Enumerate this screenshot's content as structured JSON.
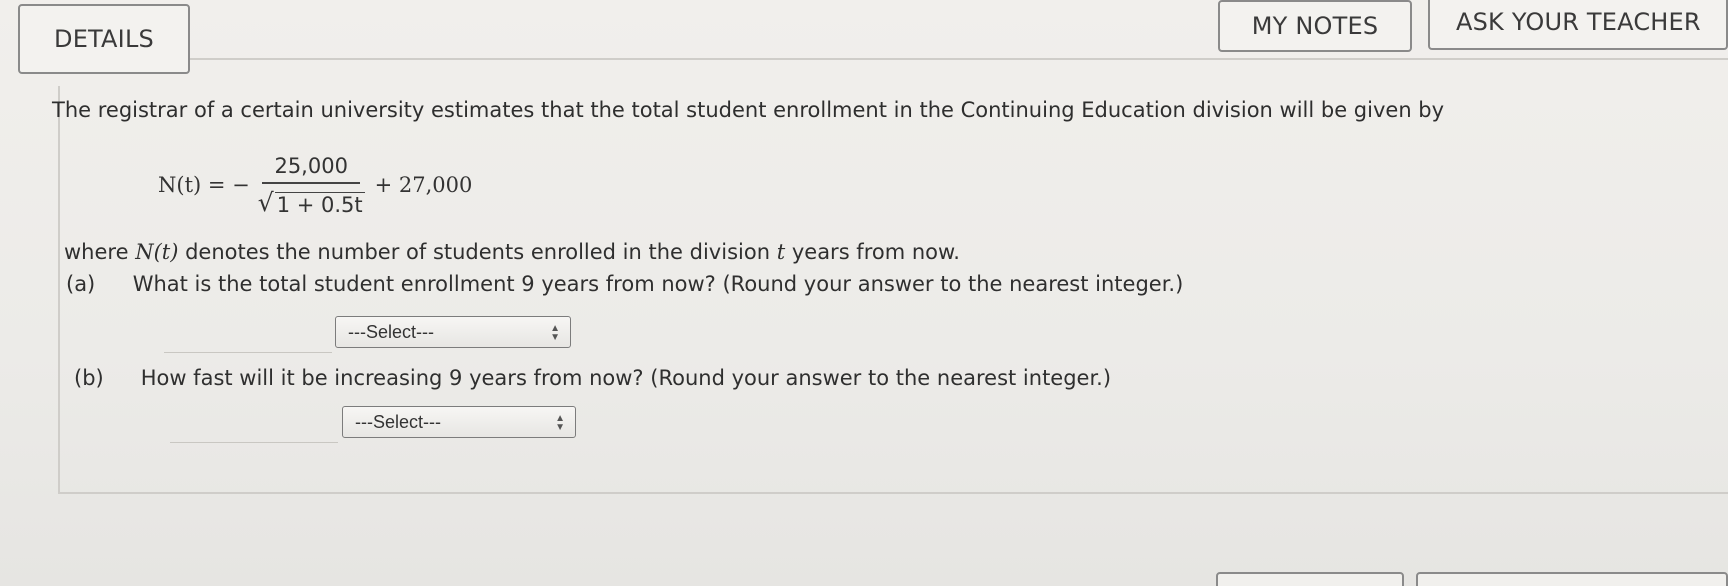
{
  "header": {
    "details_label": "DETAILS",
    "my_notes_label": "MY NOTES",
    "ask_teacher_label": "ASK YOUR TEACHER"
  },
  "problem": {
    "intro": "The registrar of a certain university estimates that the total student enrollment in the Continuing Education division will be given by",
    "formula": {
      "lhs": "N(t) = −",
      "numerator": "25,000",
      "denominator_sqrt": "1 + 0.5t",
      "rhs": "+ 27,000"
    },
    "where_prefix": "where",
    "where_var": "N(t)",
    "where_middle": "denotes the number of students enrolled in the division",
    "where_t": "t",
    "where_suffix": "years from now.",
    "parts": [
      {
        "label": "(a)",
        "question": "What is the total student enrollment 9 years from now? (Round your answer to the nearest integer.)",
        "select_value": "---Select---"
      },
      {
        "label": "(b)",
        "question": "How fast will it be increasing 9 years from now? (Round your answer to the nearest integer.)",
        "select_value": "---Select---"
      }
    ]
  }
}
